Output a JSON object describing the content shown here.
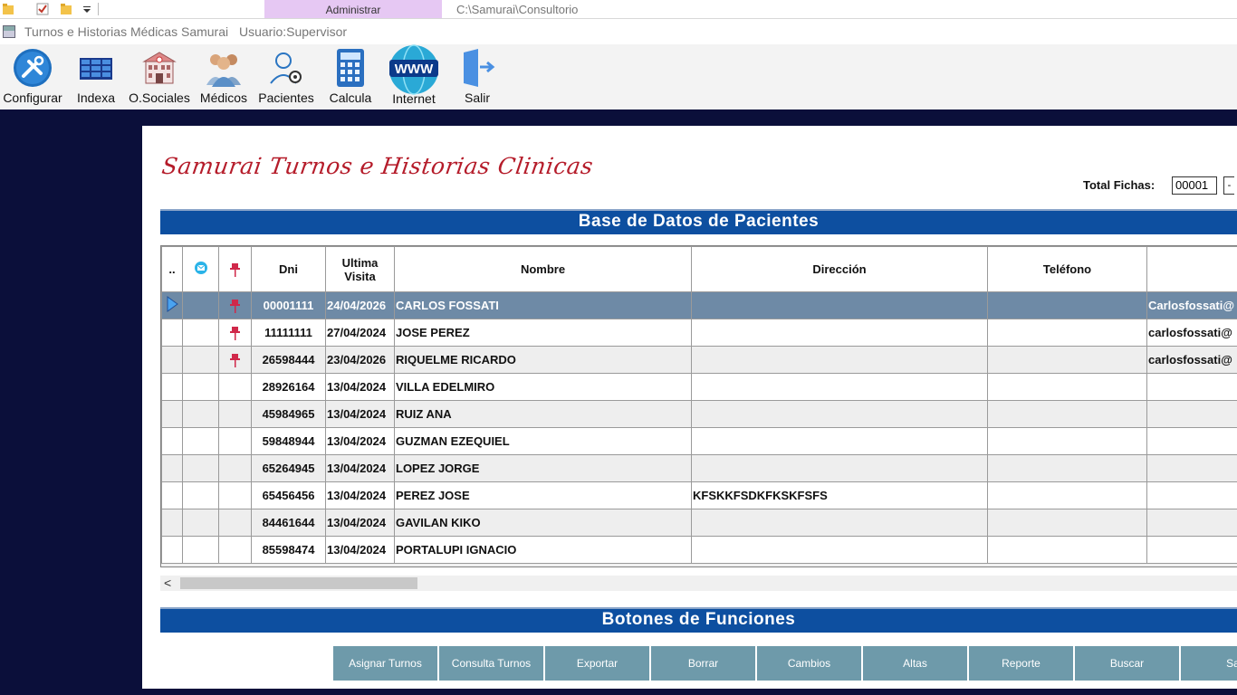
{
  "quick_access": {
    "tab": "Administrar",
    "path": "C:\\Samurai\\Consultorio"
  },
  "window": {
    "title": "Turnos e Historias Médicas Samurai",
    "user": "Usuario:Supervisor"
  },
  "toolbar": {
    "configurar": "Configurar",
    "indexa": "Indexa",
    "osociales": "O.Sociales",
    "medicos": "Médicos",
    "pacientes": "Pacientes",
    "calcula": "Calcula",
    "internet": "Internet",
    "salir": "Salir"
  },
  "header": {
    "logo_text": "Samurai Turnos e Historias Clinicas",
    "total_label": "Total Fichas:",
    "total_value": "00001"
  },
  "grid": {
    "title": "Base de Datos de Pacientes",
    "columns": {
      "marker": "..",
      "dni": "Dni",
      "ultima": "Ultima",
      "visita": "Visita",
      "nombre": "Nombre",
      "direccion": "Dirección",
      "telefono": "Teléfono"
    },
    "rows": [
      {
        "dni": "00001111",
        "visita": "24/04/2026",
        "nombre": "CARLOS FOSSATI",
        "direccion": "",
        "telefono": "",
        "email": "Carlosfossati@",
        "pinned": true,
        "selected": true
      },
      {
        "dni": "11111111",
        "visita": "27/04/2024",
        "nombre": "JOSE PEREZ",
        "direccion": "",
        "telefono": "",
        "email": "carlosfossati@",
        "pinned": true,
        "selected": false
      },
      {
        "dni": "26598444",
        "visita": "23/04/2026",
        "nombre": "RIQUELME RICARDO",
        "direccion": "",
        "telefono": "",
        "email": "carlosfossati@",
        "pinned": true,
        "selected": false
      },
      {
        "dni": "28926164",
        "visita": "13/04/2024",
        "nombre": "VILLA EDELMIRO",
        "direccion": "",
        "telefono": "",
        "email": "",
        "pinned": false,
        "selected": false
      },
      {
        "dni": "45984965",
        "visita": "13/04/2024",
        "nombre": "RUIZ ANA",
        "direccion": "",
        "telefono": "",
        "email": "",
        "pinned": false,
        "selected": false
      },
      {
        "dni": "59848944",
        "visita": "13/04/2024",
        "nombre": "GUZMAN EZEQUIEL",
        "direccion": "",
        "telefono": "",
        "email": "",
        "pinned": false,
        "selected": false
      },
      {
        "dni": "65264945",
        "visita": "13/04/2024",
        "nombre": "LOPEZ JORGE",
        "direccion": "",
        "telefono": "",
        "email": "",
        "pinned": false,
        "selected": false
      },
      {
        "dni": "65456456",
        "visita": "13/04/2024",
        "nombre": "PEREZ JOSE",
        "direccion": "KFSKKFSDKFKSKFSFS",
        "telefono": "",
        "email": "",
        "pinned": false,
        "selected": false
      },
      {
        "dni": "84461644",
        "visita": "13/04/2024",
        "nombre": "GAVILAN KIKO",
        "direccion": "",
        "telefono": "",
        "email": "",
        "pinned": false,
        "selected": false
      },
      {
        "dni": "85598474",
        "visita": "13/04/2024",
        "nombre": "PORTALUPI IGNACIO",
        "direccion": "",
        "telefono": "",
        "email": "",
        "pinned": false,
        "selected": false
      }
    ]
  },
  "functions": {
    "title": "Botones de Funciones",
    "buttons": [
      "Asignar Turnos",
      "Consulta Turnos",
      "Exportar",
      "Borrar",
      "Cambios",
      "Altas",
      "Reporte",
      "Buscar",
      "Sa"
    ]
  },
  "colors": {
    "band": "#0d4fa0",
    "selected_row": "#6e8aa6",
    "function_button": "#6e9aaa",
    "logo": "#b51c2a",
    "background": "#0b0f3a"
  }
}
